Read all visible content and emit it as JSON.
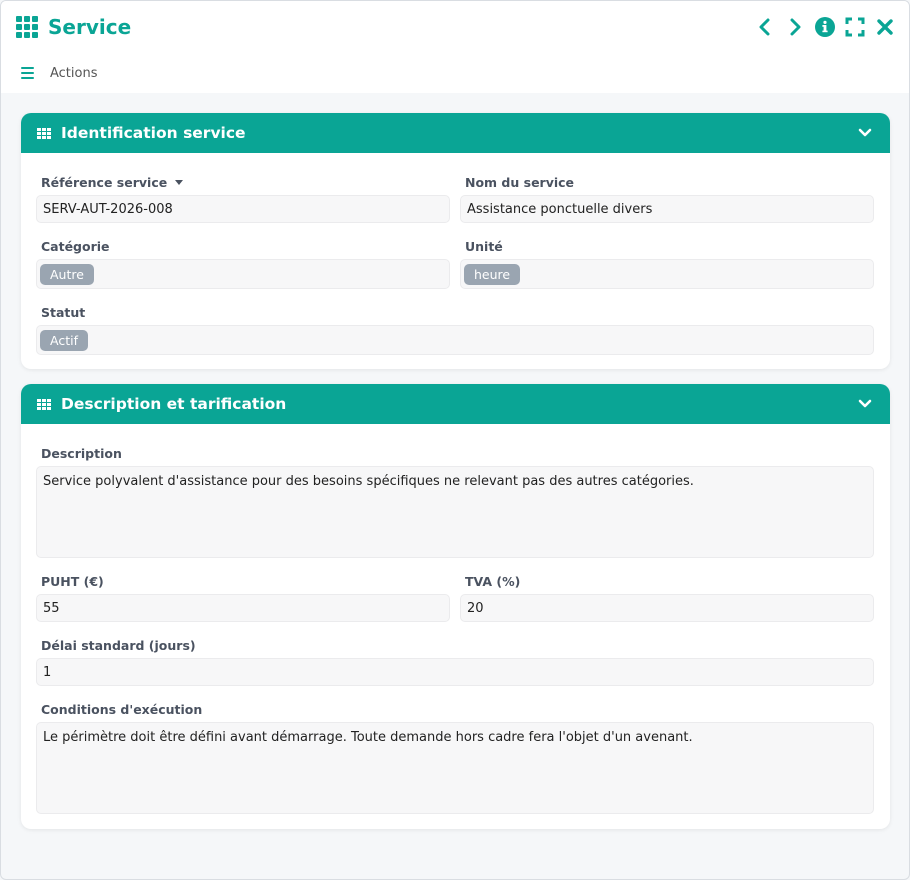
{
  "window": {
    "title": "Service",
    "actions_label": "Actions"
  },
  "icons": {
    "app": "grid-icon",
    "prev": "chevron-left-icon",
    "next": "chevron-right-icon",
    "info": "info-icon",
    "fullscreen": "fullscreen-icon",
    "close": "close-icon",
    "menu": "hamburger-icon",
    "section": "table-icon",
    "collapse": "chevron-down-icon"
  },
  "colors": {
    "accent": "#0aa595",
    "chip": "#9aa5b1"
  },
  "identification": {
    "title": "Identification service",
    "reference_label": "Référence service",
    "reference_value": "SERV-AUT-2026-008",
    "name_label": "Nom du service",
    "name_value": "Assistance ponctuelle divers",
    "category_label": "Catégorie",
    "category_value": "Autre",
    "unit_label": "Unité",
    "unit_value": "heure",
    "status_label": "Statut",
    "status_value": "Actif"
  },
  "description": {
    "title": "Description et tarification",
    "description_label": "Description",
    "description_value": "Service polyvalent d'assistance pour des besoins spécifiques ne relevant pas des autres catégories.",
    "puht_label": "PUHT (€)",
    "puht_value": "55",
    "tva_label": "TVA (%)",
    "tva_value": "20",
    "delay_label": "Délai standard (jours)",
    "delay_value": "1",
    "conditions_label": "Conditions d'exécution",
    "conditions_value": "Le périmètre doit être défini avant démarrage. Toute demande hors cadre fera l'objet d'un avenant."
  }
}
